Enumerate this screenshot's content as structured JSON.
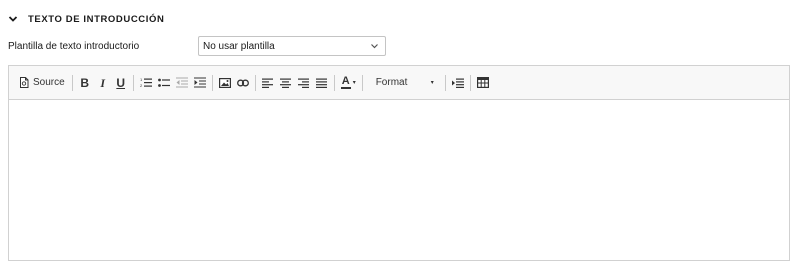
{
  "section": {
    "title": "TEXTO DE INTRODUCCIÓN",
    "icon": "chevron-down-icon"
  },
  "template_field": {
    "label": "Plantilla de texto introductorio",
    "selected": "No usar plantilla",
    "icon": "chevron-down-icon"
  },
  "editor": {
    "toolbar": {
      "source_label": "Source",
      "bold_glyph": "B",
      "italic_glyph": "I",
      "underline_glyph": "U",
      "format_label": "Format",
      "font_color_glyph": "A",
      "icons": [
        "source-icon",
        "bold-icon",
        "italic-icon",
        "underline-icon",
        "numbered-list-icon",
        "bulleted-list-icon",
        "outdent-icon",
        "indent-icon",
        "image-icon",
        "link-icon",
        "align-left-icon",
        "align-center-icon",
        "align-right-icon",
        "justify-icon",
        "font-color-icon",
        "format-dropdown",
        "blockquote-icon",
        "table-icon"
      ]
    },
    "content": ""
  },
  "colors": {
    "border": "#d1d1d1",
    "toolbar_bg": "#f8f8f8",
    "text": "#1a1a1a",
    "icon": "#333333",
    "disabled_icon": "#9a9a9a"
  }
}
